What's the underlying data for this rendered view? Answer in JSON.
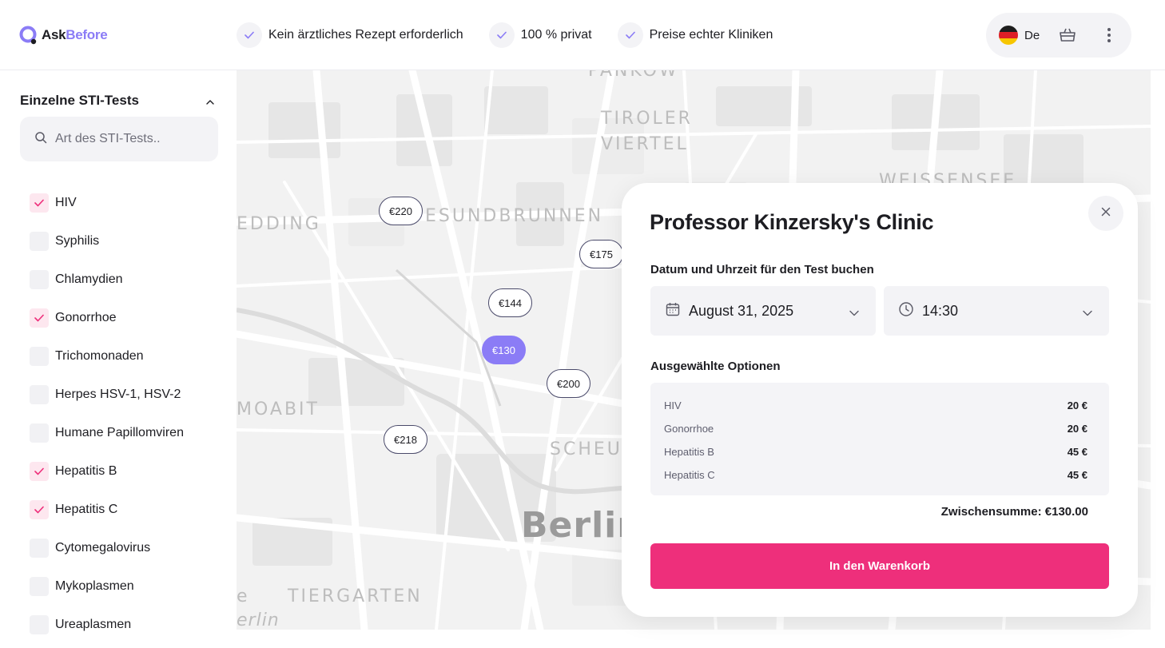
{
  "brand": {
    "name_part1": "Ask",
    "name_part2": "Before",
    "accent_color": "#8b7cf6",
    "cta_color": "#ee2f7b"
  },
  "header": {
    "features": [
      {
        "icon": "check-icon",
        "label": "Kein ärztliches Rezept erforderlich"
      },
      {
        "icon": "check-icon",
        "label": "100 % privat"
      },
      {
        "icon": "check-icon",
        "label": "Preise echter Kliniken"
      }
    ],
    "language": {
      "flag": "germany-flag-icon",
      "label": "De"
    },
    "cart_icon": "basket-icon",
    "menu_icon": "more-vertical-icon"
  },
  "sidebar": {
    "title": "Einzelne STI-Tests",
    "search_placeholder": "Art des STI-Tests..",
    "items": [
      {
        "label": "HIV",
        "checked": true
      },
      {
        "label": "Syphilis",
        "checked": false
      },
      {
        "label": "Chlamydien",
        "checked": false
      },
      {
        "label": "Gonorrhoe",
        "checked": true
      },
      {
        "label": "Trichomonaden",
        "checked": false
      },
      {
        "label": "Herpes HSV-1, HSV-2",
        "checked": false
      },
      {
        "label": "Humane Papillomviren",
        "checked": false
      },
      {
        "label": "Hepatitis B",
        "checked": true
      },
      {
        "label": "Hepatitis C",
        "checked": true
      },
      {
        "label": "Cytomegalovirus",
        "checked": false
      },
      {
        "label": "Mykoplasmen",
        "checked": false
      },
      {
        "label": "Ureaplasmen",
        "checked": false
      }
    ]
  },
  "map": {
    "labels": {
      "pankow": "PANKOW",
      "tiroler1": "TIROLER",
      "tiroler2": "VIERTEL",
      "weissensee": "WEISSENSEE",
      "wedding": "EDDING",
      "gesundbrunnen": "ESUNDBRUNNEN",
      "moabit": "MOABIT",
      "scheunen": "SCHEUN",
      "tiergarten": "TIERGARTEN",
      "berlin": "Berlin",
      "berlin_italic": "erlin",
      "edge_e": "e"
    },
    "pins": [
      {
        "label": "€220",
        "active": false
      },
      {
        "label": "€175",
        "active": false
      },
      {
        "label": "€144",
        "active": false
      },
      {
        "label": "€130",
        "active": true
      },
      {
        "label": "€200",
        "active": false
      },
      {
        "label": "€218",
        "active": false
      }
    ]
  },
  "modal": {
    "title": "Professor Kinzersky's Clinic",
    "booking_label": "Datum und Uhrzeit für den Test buchen",
    "date_value": "August 31, 2025",
    "time_value": "14:30",
    "options_label": "Ausgewählte Optionen",
    "options": [
      {
        "name": "HIV",
        "price": "20 €"
      },
      {
        "name": "Gonorrhoe",
        "price": "20 €"
      },
      {
        "name": "Hepatitis B",
        "price": "45 €"
      },
      {
        "name": "Hepatitis C",
        "price": "45 €"
      }
    ],
    "subtotal": "Zwischensumme: €130.00",
    "cta": "In den Warenkorb"
  }
}
